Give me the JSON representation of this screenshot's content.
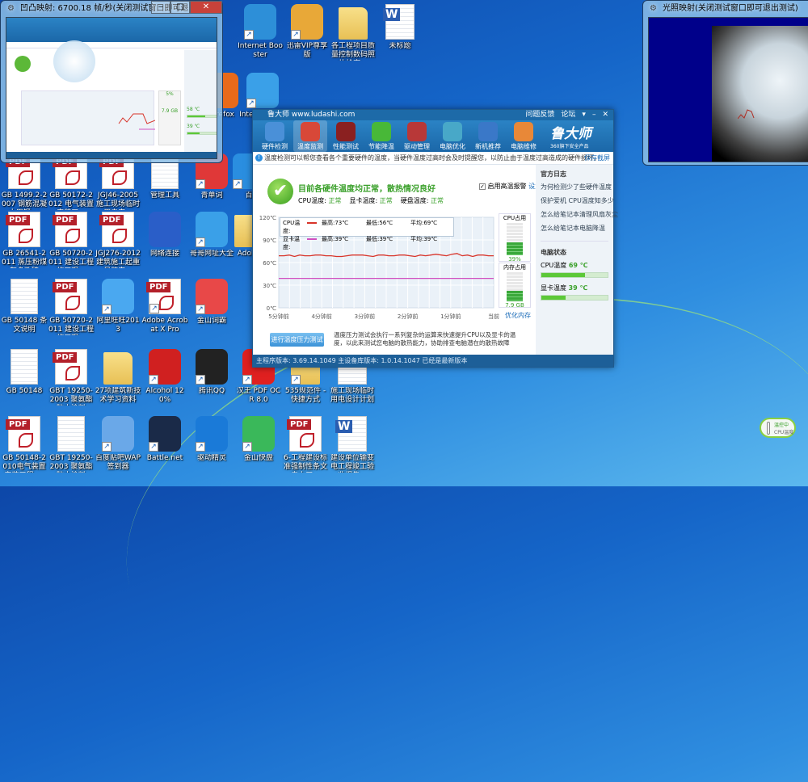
{
  "desktop": {
    "icons": [
      {
        "icon": "internet-booster-icon",
        "type": "app",
        "color": "#2d8fd8",
        "label": "Internet Booster",
        "sc": true
      },
      {
        "icon": "xunlei-icon",
        "type": "app",
        "color": "#e8a838",
        "label": "迅雷VIP尊享版",
        "sc": true
      },
      {
        "icon": "folder-icon",
        "type": "folder",
        "label": "各工程项目质量控制数码照片检查..."
      },
      {
        "icon": "word-doc-icon",
        "type": "word",
        "label": "未标题"
      },
      {
        "icon": "firefox-icon",
        "type": "app",
        "color": "#e86a1a",
        "label": "Firefox",
        "sc": true
      },
      {
        "icon": "ie-icon",
        "type": "app",
        "color": "#3aa0e8",
        "label": "Internet Explorer",
        "sc": true
      },
      {
        "icon": "pdf-icon",
        "type": "pdf",
        "label": "GB 1499.2-2007 钢筋混凝土用钢 ..."
      },
      {
        "icon": "pdf-icon",
        "type": "pdf",
        "label": "GB 50172-2012 电气装置安装工..."
      },
      {
        "icon": "pdf-icon",
        "type": "pdf",
        "label": "JGJ46-2005 施工现场临时用电安..."
      },
      {
        "icon": "admin-tools-icon",
        "type": "doc",
        "label": "管理工具"
      },
      {
        "icon": "qingdanci-icon",
        "type": "app",
        "color": "#e03838",
        "label": "青单词",
        "sc": true
      },
      {
        "icon": "baidu-icon",
        "type": "app",
        "color": "#2a8ee0",
        "label": "百",
        "sc": true
      },
      {
        "icon": "pdf-icon",
        "type": "pdf",
        "label": "GB 26541-2011 蒸压粉煤灰多孔砖"
      },
      {
        "icon": "pdf-icon",
        "type": "pdf",
        "label": "GB 50720-2011 建设工程施工现..."
      },
      {
        "icon": "pdf-icon",
        "type": "pdf",
        "label": "JGJ276-2012建筑施工起重吊装安..."
      },
      {
        "icon": "network-icon",
        "type": "app",
        "color": "#2a5ec8",
        "label": "网络连接"
      },
      {
        "icon": "ie-icon",
        "type": "app",
        "color": "#3aa0e8",
        "label": "哥哥网址大全",
        "sc": true
      },
      {
        "icon": "folder-icon",
        "type": "folder",
        "label": "Adobe"
      },
      {
        "icon": "text-file-icon",
        "type": "doc",
        "label": "GB 50148 条文说明"
      },
      {
        "icon": "pdf-icon",
        "type": "pdf",
        "label": "GB 50720-2011 建设工程施工现..."
      },
      {
        "icon": "wangwang-icon",
        "type": "app",
        "color": "#4aa8f0",
        "label": "阿里旺旺2013",
        "sc": true
      },
      {
        "icon": "acrobat-icon",
        "type": "pdf",
        "label": "Adobe Acrobat X Pro",
        "sc": true
      },
      {
        "icon": "dictionary-icon",
        "type": "app",
        "color": "#e84848",
        "label": "金山词霸",
        "sc": true
      },
      {
        "icon": "text-file-icon",
        "type": "doc",
        "label": "GB 50148"
      },
      {
        "icon": "pdf-icon",
        "type": "pdf",
        "label": "GBT 19250-2003 聚氨酯防水涂料"
      },
      {
        "icon": "folder-icon",
        "type": "folder",
        "label": "27项建筑新技术学习资料"
      },
      {
        "icon": "alcohol-icon",
        "type": "app",
        "color": "#d02020",
        "label": "Alcohol 120%",
        "sc": true
      },
      {
        "icon": "qq-icon",
        "type": "app",
        "color": "#222",
        "label": "腾讯QQ",
        "sc": true
      },
      {
        "icon": "hanwang-icon",
        "type": "app",
        "color": "#e02020",
        "label": "汉王 PDF OCR 8.0",
        "sc": true
      },
      {
        "icon": "folder-icon",
        "type": "folder",
        "label": "535规范件 - 快捷方式",
        "sc": true
      },
      {
        "icon": "word-doc-icon",
        "type": "word",
        "label": "施工现场临时用电设计计划"
      },
      {
        "icon": "pdf-icon",
        "type": "pdf",
        "label": "GB 50148-2010电气装置安装工程_..."
      },
      {
        "icon": "text-file-icon",
        "type": "doc",
        "label": "GBT 19250-2003 聚氨酯防水涂料"
      },
      {
        "icon": "tieba-icon",
        "type": "app",
        "color": "#6aa8e8",
        "label": "百度贴吧WAP签到器",
        "sc": true
      },
      {
        "icon": "battlenet-icon",
        "type": "app",
        "color": "#1a2a48",
        "label": "Battle.net",
        "sc": true
      },
      {
        "icon": "app-icon",
        "type": "app",
        "color": "#1a7ad8",
        "label": "驱动精灵",
        "sc": true
      },
      {
        "icon": "kuaipan-icon",
        "type": "app",
        "color": "#3ab85a",
        "label": "金山快盘",
        "sc": true
      },
      {
        "icon": "pdf-icon",
        "type": "pdf",
        "label": "6-工程建设标准强制性条文 电力工..."
      },
      {
        "icon": "word-doc-icon",
        "type": "word",
        "label": "建设单位输变电工程竣工验收报告..."
      }
    ]
  },
  "bump_window": {
    "title": "凹凸映射: 6700.18 帧/秒(关闭测试窗口即可退出测试)",
    "cpu_temp": "58 ℃",
    "gpu_temp": "39 ℃",
    "cpu_usage": "5%",
    "mem": "7.9 GB"
  },
  "light_window": {
    "title": "光照映射(关闭测试窗口即可退出测试)"
  },
  "main": {
    "title": "鲁大师 www.ludashi.com",
    "links": [
      "问题反馈",
      "论坛"
    ],
    "tabs": [
      {
        "label": "硬件检测",
        "color": "#4a90d8"
      },
      {
        "label": "温度监测",
        "color": "#d84838"
      },
      {
        "label": "性能测试",
        "color": "#8a2020"
      },
      {
        "label": "节能降温",
        "color": "#48b838"
      },
      {
        "label": "驱动管理",
        "color": "#b83838"
      },
      {
        "label": "电脑优化",
        "color": "#48a8c8"
      },
      {
        "label": "新机推荐",
        "color": "#3a78c8"
      },
      {
        "label": "电脑维修",
        "color": "#e88838"
      }
    ],
    "selected_tab": 1,
    "logo": "鲁大师",
    "logo_sub": "360旗下安全产品",
    "info": "温度检测可以帮您查看各个重要硬件的温度，当硬件温度过高时会及时提醒您，以防止由于温度过高造成的硬件损坏。",
    "save_screenshot": "保存截屏",
    "headline": "目前各硬件温度均正常，散热情况良好",
    "alarm_label": "启用高温报警",
    "alarm_checked": true,
    "settings": "设置",
    "status": [
      {
        "label": "CPU温度:",
        "value": "正常"
      },
      {
        "label": "显卡温度:",
        "value": "正常"
      },
      {
        "label": "硬盘温度:",
        "value": "正常"
      }
    ],
    "chart": {
      "y_ticks": [
        "120℃",
        "90℃",
        "60℃",
        "30℃",
        "0℃"
      ],
      "x_ticks": [
        "5分钟前",
        "4分钟前",
        "3分钟前",
        "2分钟前",
        "1分钟前",
        "当前"
      ],
      "legend": [
        {
          "name": "CPU温度:",
          "color": "#d8342a",
          "max": "最高:73℃",
          "min": "最低:56℃",
          "avg": "平均:69℃"
        },
        {
          "name": "显卡温度:",
          "color": "#d050c0",
          "max": "最高:39℃",
          "min": "最低:39℃",
          "avg": "平均:39℃"
        }
      ],
      "cpu": [
        69,
        69,
        70,
        68,
        70,
        69,
        69,
        70,
        70,
        69,
        69,
        68,
        68,
        69,
        70,
        70,
        70,
        69,
        68,
        70,
        70,
        69,
        69,
        70,
        70,
        69,
        68,
        70,
        69,
        70,
        71,
        70,
        69,
        71,
        72,
        69,
        70,
        68,
        70,
        70,
        69,
        69
      ],
      "gpu": [
        39,
        39
      ]
    },
    "cpu_usage_label": "CPU占用",
    "cpu_usage": "39%",
    "cpu_usage_pct": 39,
    "mem_label": "内存占用",
    "mem": "7.9 GB",
    "mem_pct": 35,
    "optimize_mem": "优化内存",
    "stress_button": "进行温度压力测试",
    "stress_desc": "温度压力测试会执行一系列复杂的运算来快速提升CPU以及显卡的温度，以此来测试您电脑的散热能力，协助排查电脑潜在的散热故障",
    "sidebar": {
      "log_title": "官方日志",
      "links": [
        "为何检测少了些硬件温度",
        "保护爱机 CPU温度知多少",
        "怎么给笔记本清理风扇灰尘",
        "怎么给笔记本电脑降温"
      ],
      "status_title": "电脑状态",
      "cpu_label": "CPU温度",
      "cpu_value": "69 ℃",
      "cpu_pct": 66,
      "gpu_label": "显卡温度",
      "gpu_value": "39 ℃",
      "gpu_pct": 37
    },
    "footer": "主程序版本: 3.69.14.1049   主设备库版本: 1.0.14.1047   已经是最新版本"
  },
  "widget": {
    "line1": "温控中",
    "line2": "CPU温度"
  }
}
